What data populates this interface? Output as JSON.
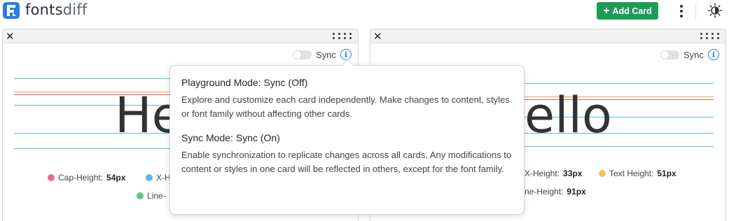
{
  "app": {
    "name_main": "fonts",
    "name_accent": "diff"
  },
  "toolbar": {
    "add_card_label": "Add Card",
    "add_icon": "plus-icon",
    "menu_icon": "more-vertical-icon",
    "theme_icon": "sun-icon"
  },
  "colors": {
    "brand_blue": "#2c7be5",
    "add_button_green": "#1e9c58",
    "cap_height": "#f06b8a",
    "x_height": "#55b8f2",
    "text_height": "#f4c35a",
    "line_height": "#5cc98a",
    "guide_red": "#e55a5a",
    "guide_orange": "#f0a050"
  },
  "cards": [
    {
      "sample_text": "He",
      "sync_label": "Sync",
      "metrics": [
        {
          "label": "Cap-Height:",
          "value": "54px"
        },
        {
          "label": "X-H",
          "value": ""
        },
        {
          "label": "Line-",
          "value": ""
        }
      ]
    },
    {
      "sample_text": "ello",
      "sync_label": "Sync",
      "metrics": [
        {
          "label": "X-Height:",
          "value": "33px"
        },
        {
          "label": "Text Height:",
          "value": "51px"
        },
        {
          "label": "ne-Height:",
          "value": "91px"
        }
      ]
    }
  ],
  "tooltip": {
    "playground_title": "Playground Mode: Sync (Off)",
    "playground_text": "Explore and customize each card independently. Make changes to content, styles or font family without affecting other cards.",
    "sync_title": "Sync Mode: Sync (On)",
    "sync_text": "Enable synchronization to replicate changes across all cards. Any modifications to content or styles in one card will be reflected in others, except for the font family."
  }
}
